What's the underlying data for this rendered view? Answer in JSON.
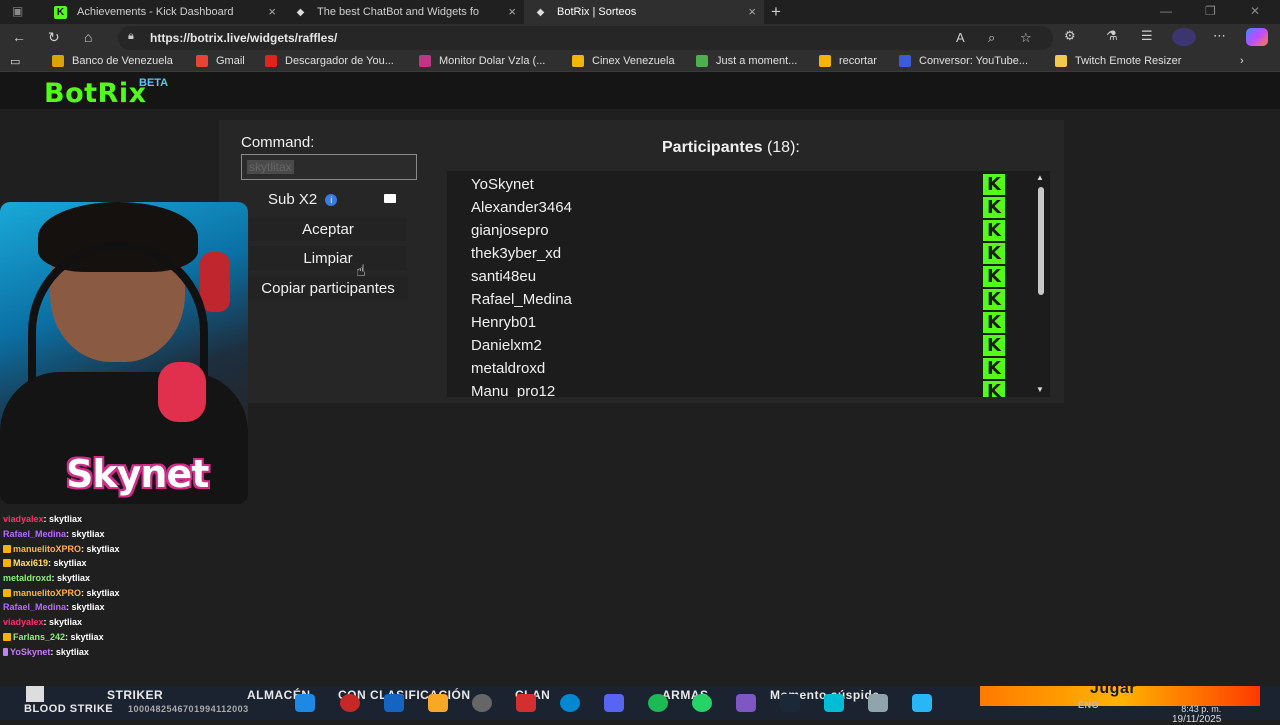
{
  "browser": {
    "tabs": [
      {
        "title": "Achievements - Kick Dashboard",
        "icon": "kick-icon"
      },
      {
        "title": "The best ChatBot and Widgets fo",
        "icon": "botrix-icon"
      },
      {
        "title": "BotRix | Sorteos",
        "icon": "botrix-icon"
      }
    ],
    "url": "https://botrix.live/widgets/raffles/",
    "bookmarks": [
      {
        "label": "Banco de Venezuela",
        "color": "#d9a400"
      },
      {
        "label": "Gmail",
        "color": "#ea4335"
      },
      {
        "label": "Descargador de You...",
        "color": "#e0241c"
      },
      {
        "label": "Monitor Dolar Vzla (...",
        "color": "#c13584"
      },
      {
        "label": "Cinex Venezuela",
        "color": "#f2b705"
      },
      {
        "label": "Just a moment...",
        "color": "#4caf50"
      },
      {
        "label": "recortar",
        "color": "#f5b400"
      },
      {
        "label": "Conversor: YouTube...",
        "color": "#3b5bdb"
      },
      {
        "label": "Twitch Emote Resizer",
        "color": "#f2c94c"
      }
    ]
  },
  "site": {
    "logo": "BotRix",
    "beta": "BETA"
  },
  "raffle": {
    "command_label": "Command:",
    "command_value": "skytlitax",
    "sub_label": "Sub X2",
    "info_glyph": "i",
    "accept_label": "Aceptar",
    "clear_label": "Limpiar",
    "copy_label": "Copiar participantes",
    "participants_title": "Participantes",
    "participants_count": "(18):",
    "participants": [
      "YoSkynet",
      "Alexander3464",
      "gianjosepro",
      "thek3yber_xd",
      "santi48eu",
      "Rafael_Medina",
      "Henryb01",
      "Danielxm2",
      "metaldroxd",
      "Manu_pro12"
    ]
  },
  "stream": {
    "cam_name": "Skynet",
    "chat": [
      {
        "user": "viadyalex",
        "msg": ": skytliax",
        "color": "#ff2d6f",
        "badge": ""
      },
      {
        "user": "Rafael_Medina",
        "msg": ": skytliax",
        "color": "#b36bff",
        "badge": ""
      },
      {
        "user": "manuelitoXPRO",
        "msg": ": skytliax",
        "color": "#ffb347",
        "badge": "#f5b400"
      },
      {
        "user": "Maxi619",
        "msg": ": skytliax",
        "color": "#ffe066",
        "badge": "#f5b400"
      },
      {
        "user": "metaldroxd",
        "msg": ": skytliax",
        "color": "#8ef07a",
        "badge": ""
      },
      {
        "user": "manuelitoXPRO",
        "msg": ": skytliax",
        "color": "#ffb347",
        "badge": "#f5b400"
      },
      {
        "user": "Rafael_Medina",
        "msg": ": skytliax",
        "color": "#b36bff",
        "badge": ""
      },
      {
        "user": "viadyalex",
        "msg": ": skytliax",
        "color": "#ff2d6f",
        "badge": ""
      },
      {
        "user": "Farlans_242",
        "msg": ": skytliax",
        "color": "#8ef07a",
        "badge": "#f5b400"
      },
      {
        "user": "YoSkynet",
        "msg": ": skytliax",
        "color": "#c77dff",
        "badge": "#c77dff"
      }
    ]
  },
  "taskbar": {
    "game_title": "STRIKER",
    "game_sub": "BLOOD STRIKE",
    "game_id": "1000482546701994112003",
    "store": "ALMACÉN",
    "ranked": "CON CLASIFICACIÓN",
    "clan": "CLAN",
    "armas": "ARMAS",
    "moment": "Momento cúspide",
    "jugar": "Jugar",
    "lang": "ENG",
    "time": "8:43 p. m.",
    "date": "19/11/2025"
  }
}
